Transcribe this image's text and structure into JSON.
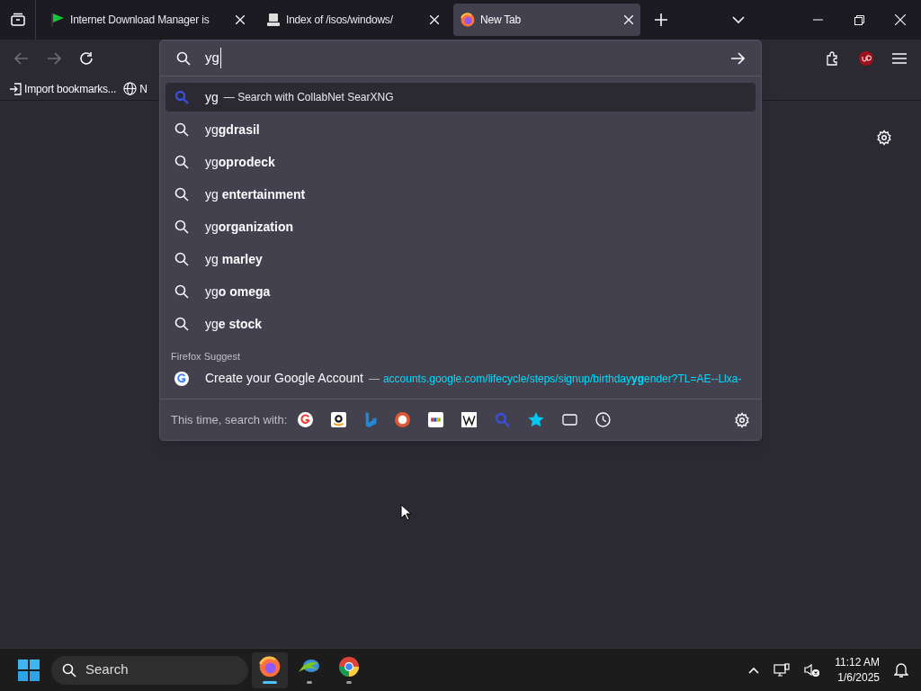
{
  "tabs": [
    {
      "kind": "flag",
      "title": "Internet Download Manager is",
      "selected": false
    },
    {
      "kind": "server",
      "title": "Index of /isos/windows/",
      "selected": false
    },
    {
      "kind": "firefox",
      "title": "New Tab",
      "selected": true
    }
  ],
  "bookmarks": [
    {
      "kind": "import",
      "label": "Import bookmarks..."
    },
    {
      "kind": "globe",
      "label": "N"
    }
  ],
  "urlbar": {
    "value": "yg"
  },
  "suggestions": [
    {
      "kind": "engine",
      "text": "yg",
      "separator": "—",
      "action": "Search with CollabNet SearXNG",
      "selected": true
    },
    {
      "kind": "search",
      "text": "yg**gdrasil**",
      "selected": false
    },
    {
      "kind": "search",
      "text": "yg**oprodeck**",
      "selected": false
    },
    {
      "kind": "search",
      "text": "yg **entertainment**",
      "selected": false
    },
    {
      "kind": "search",
      "text": "yg**organization**",
      "selected": false
    },
    {
      "kind": "search",
      "text": "yg **marley**",
      "selected": false
    },
    {
      "kind": "search",
      "text": "yg**o omega**",
      "selected": false
    },
    {
      "kind": "search",
      "text": "yg**e stock**",
      "selected": false
    }
  ],
  "firefox_suggest": {
    "heading": "Firefox Suggest",
    "title": "Create your Google Account",
    "separator": "—",
    "url": "accounts.google.com/lifecycle/steps/signup/birthday**yg**ender?TL=AE--Llxa-"
  },
  "search_with": {
    "label": "This time, search with:",
    "engines": [
      {
        "kind": "google"
      },
      {
        "kind": "amazon"
      },
      {
        "kind": "bing"
      },
      {
        "kind": "duckduckgo"
      },
      {
        "kind": "ebay"
      },
      {
        "kind": "wikipedia"
      },
      {
        "kind": "searxng"
      },
      {
        "kind": "bookmarks"
      },
      {
        "kind": "tabs"
      },
      {
        "kind": "history"
      }
    ]
  },
  "taskbar": {
    "search_placeholder": "Search",
    "apps": [
      {
        "kind": "firefox",
        "active": true
      },
      {
        "kind": "idm",
        "active": false
      },
      {
        "kind": "chrome",
        "active": false
      }
    ],
    "time": "11:12 AM",
    "date": "1/6/2025"
  }
}
